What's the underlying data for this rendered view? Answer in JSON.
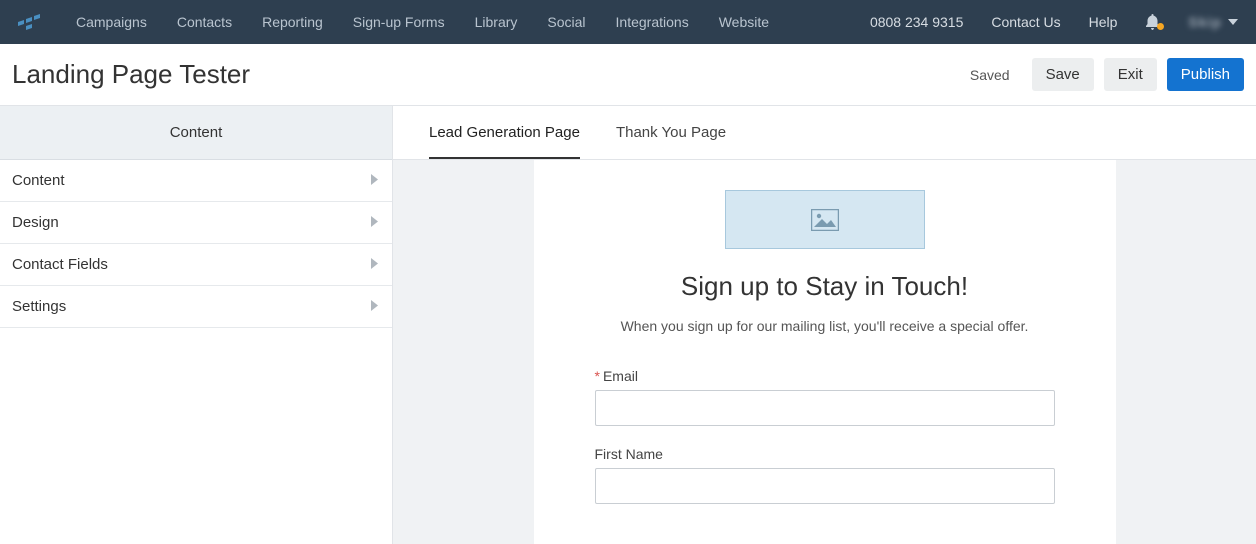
{
  "topnav": {
    "links": [
      "Campaigns",
      "Contacts",
      "Reporting",
      "Sign-up Forms",
      "Library",
      "Social",
      "Integrations",
      "Website"
    ],
    "phone": "0808 234 9315",
    "contact": "Contact Us",
    "help": "Help",
    "user_blur": "Skip"
  },
  "header": {
    "title": "Landing Page Tester",
    "status": "Saved",
    "save": "Save",
    "exit": "Exit",
    "publish": "Publish"
  },
  "sidebar": {
    "tab_label": "Content",
    "items": [
      "Content",
      "Design",
      "Contact Fields",
      "Settings"
    ]
  },
  "tabs": {
    "items": [
      {
        "label": "Lead Generation Page",
        "active": true
      },
      {
        "label": "Thank You Page",
        "active": false
      }
    ]
  },
  "canvas": {
    "heading": "Sign up to Stay in Touch!",
    "subtext": "When you sign up for our mailing list, you'll receive a special offer.",
    "fields": [
      {
        "label": "Email",
        "required": true
      },
      {
        "label": "First Name",
        "required": false
      }
    ]
  }
}
